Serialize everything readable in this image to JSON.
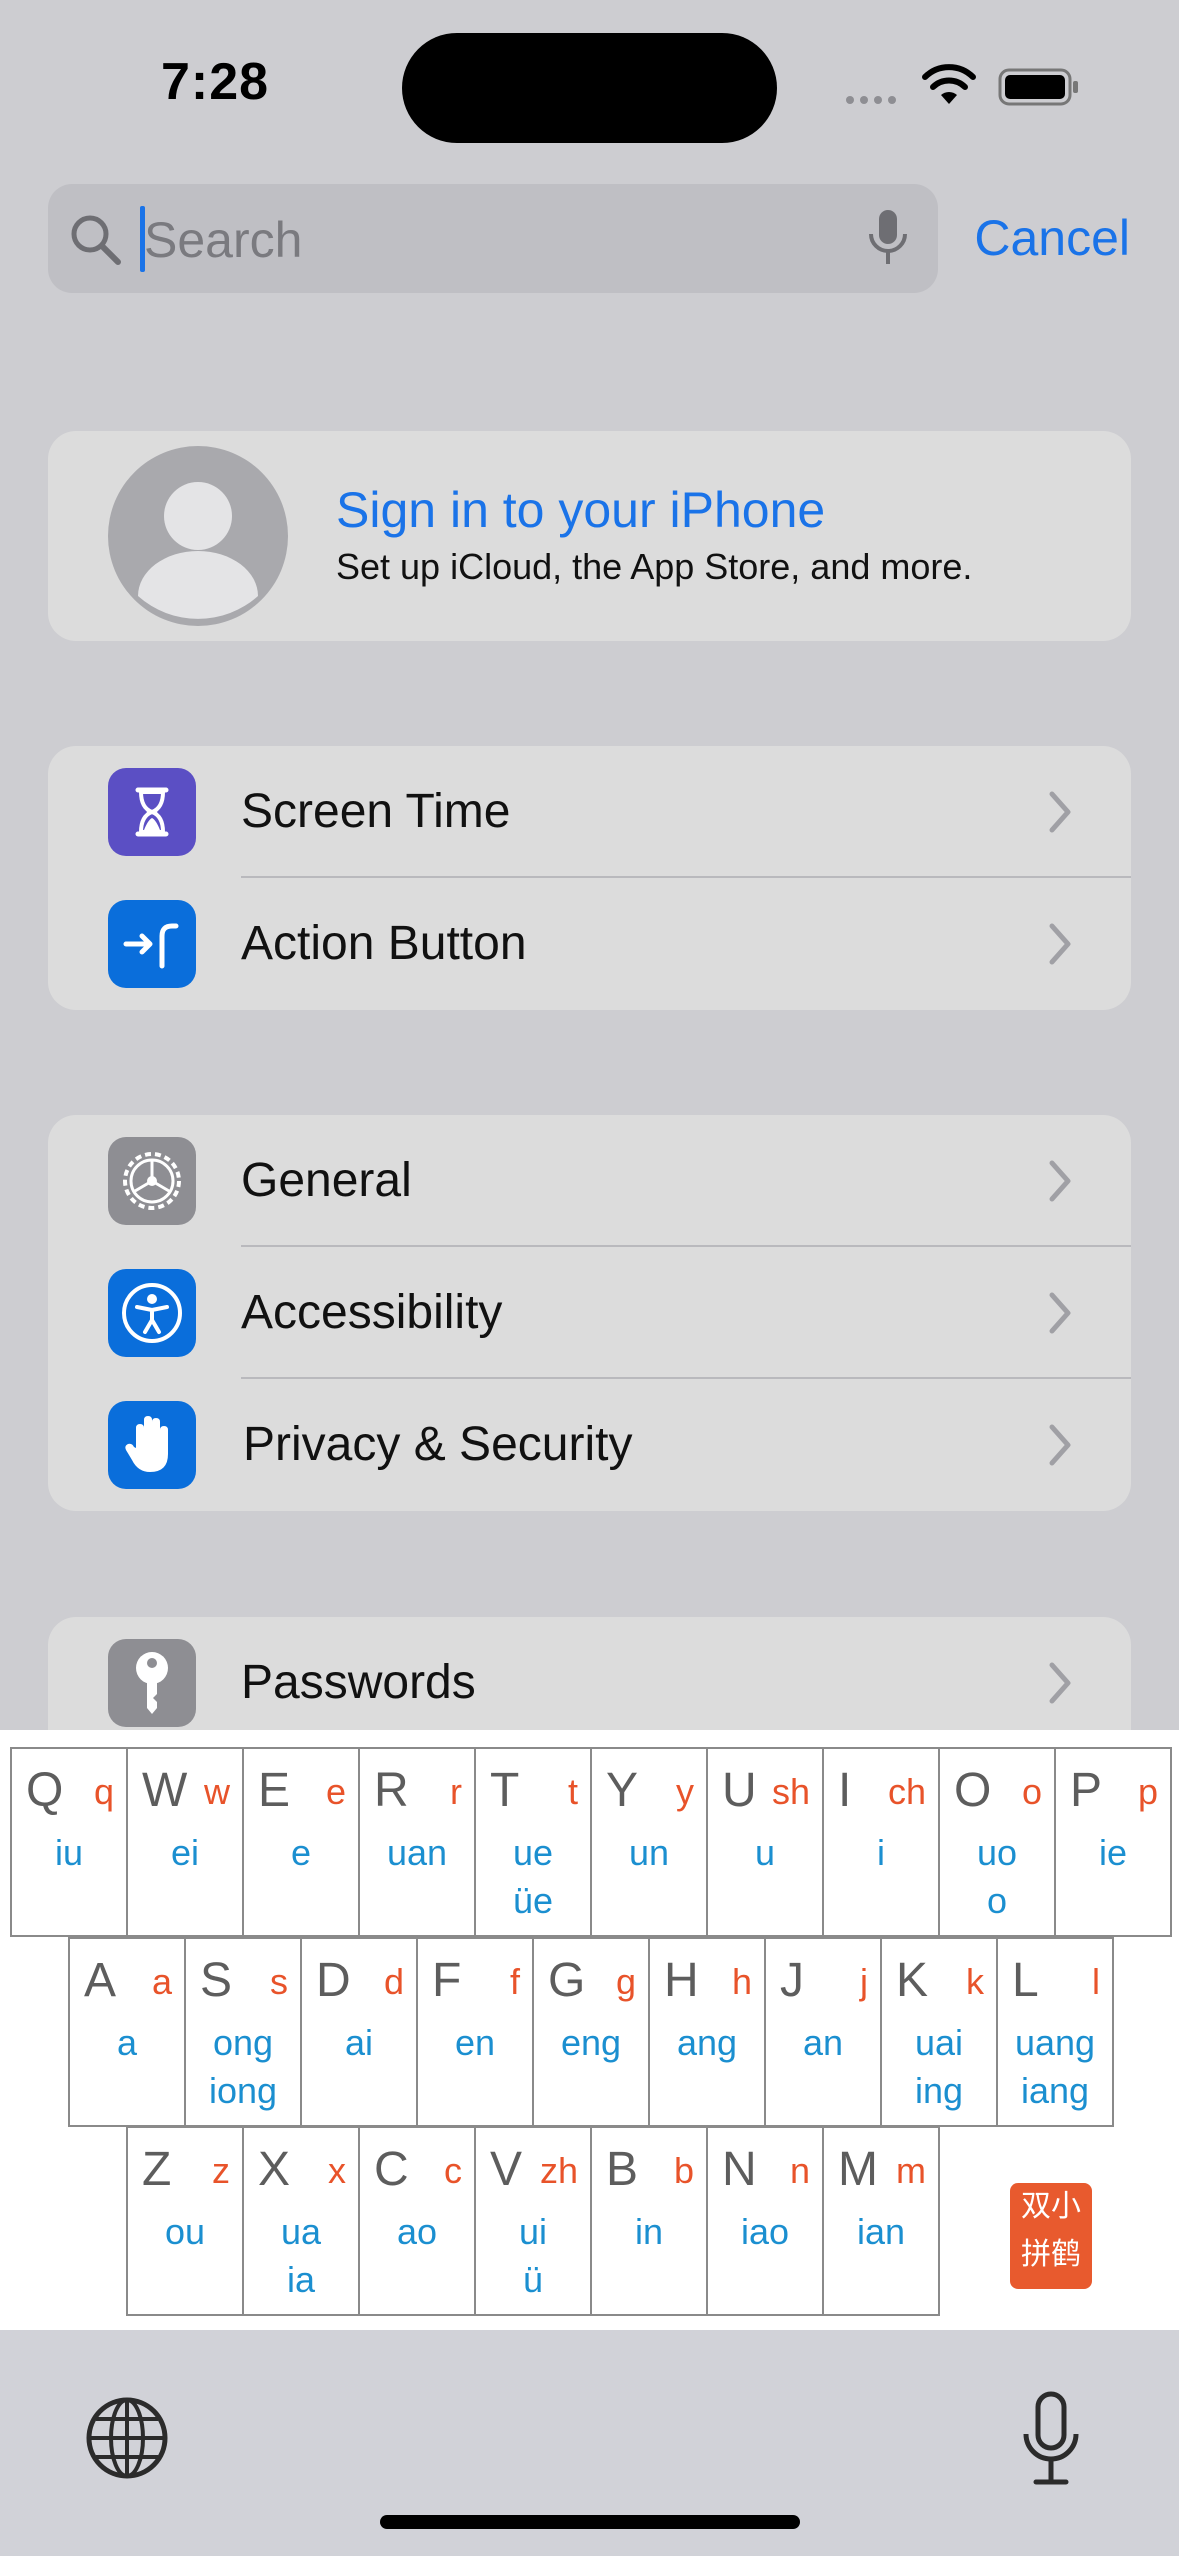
{
  "status_bar": {
    "time": "7:28"
  },
  "search": {
    "placeholder": "Search",
    "cancel_label": "Cancel"
  },
  "signin": {
    "title": "Sign in to your iPhone",
    "subtitle": "Set up iCloud, the App Store, and more."
  },
  "settings": {
    "group1": [
      {
        "label": "Screen Time",
        "icon": "hourglass-icon",
        "color": "#5b4fc4"
      },
      {
        "label": "Action Button",
        "icon": "action-button-icon",
        "color": "#0a6edb"
      }
    ],
    "group2": [
      {
        "label": "General",
        "icon": "gear-icon",
        "color": "#8e8e93"
      },
      {
        "label": "Accessibility",
        "icon": "accessibility-icon",
        "color": "#0a6edb"
      },
      {
        "label": "Privacy & Security",
        "icon": "hand-icon",
        "color": "#0a6edb"
      }
    ],
    "group3": [
      {
        "label": "Passwords",
        "icon": "key-icon",
        "color": "#8e8e93"
      }
    ]
  },
  "keyboard": {
    "row1": [
      {
        "upper": "Q",
        "shengmu": "q",
        "yunmu": "iu"
      },
      {
        "upper": "W",
        "shengmu": "w",
        "yunmu": "ei"
      },
      {
        "upper": "E",
        "shengmu": "e",
        "yunmu": "e"
      },
      {
        "upper": "R",
        "shengmu": "r",
        "yunmu": "uan"
      },
      {
        "upper": "T",
        "shengmu": "t",
        "yunmu": "ue\nüe"
      },
      {
        "upper": "Y",
        "shengmu": "y",
        "yunmu": "un"
      },
      {
        "upper": "U",
        "shengmu": "sh",
        "yunmu": "u"
      },
      {
        "upper": "I",
        "shengmu": "ch",
        "yunmu": "i"
      },
      {
        "upper": "O",
        "shengmu": "o",
        "yunmu": "uo\no"
      },
      {
        "upper": "P",
        "shengmu": "p",
        "yunmu": "ie"
      }
    ],
    "row2": [
      {
        "upper": "A",
        "shengmu": "a",
        "yunmu": "a"
      },
      {
        "upper": "S",
        "shengmu": "s",
        "yunmu": "ong\niong"
      },
      {
        "upper": "D",
        "shengmu": "d",
        "yunmu": "ai"
      },
      {
        "upper": "F",
        "shengmu": "f",
        "yunmu": "en"
      },
      {
        "upper": "G",
        "shengmu": "g",
        "yunmu": "eng"
      },
      {
        "upper": "H",
        "shengmu": "h",
        "yunmu": "ang"
      },
      {
        "upper": "J",
        "shengmu": "j",
        "yunmu": "an"
      },
      {
        "upper": "K",
        "shengmu": "k",
        "yunmu": "uai\ning"
      },
      {
        "upper": "L",
        "shengmu": "l",
        "yunmu": "uang\niang"
      }
    ],
    "row3": [
      {
        "upper": "Z",
        "shengmu": "z",
        "yunmu": "ou"
      },
      {
        "upper": "X",
        "shengmu": "x",
        "yunmu": "ua\nia"
      },
      {
        "upper": "C",
        "shengmu": "c",
        "yunmu": "ao"
      },
      {
        "upper": "V",
        "shengmu": "zh",
        "yunmu": "ui\nü"
      },
      {
        "upper": "B",
        "shengmu": "b",
        "yunmu": "in"
      },
      {
        "upper": "N",
        "shengmu": "n",
        "yunmu": "iao"
      },
      {
        "upper": "M",
        "shengmu": "m",
        "yunmu": "ian"
      }
    ],
    "seal_text": "双小\n拼鹤"
  }
}
